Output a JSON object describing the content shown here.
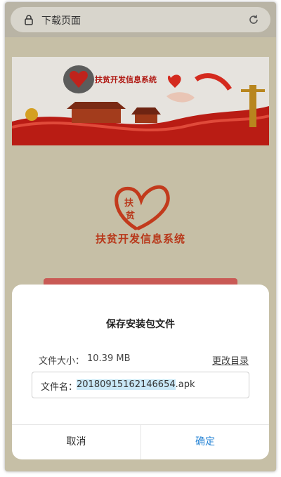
{
  "browser": {
    "page_title": "下载页面"
  },
  "page": {
    "banner_title": "扶贫开发信息系统",
    "logo_caption": "扶贫开发信息系统",
    "logo_glyph": "扶\n贫"
  },
  "dialog": {
    "title": "保存安装包文件",
    "size_label": "文件大小：",
    "size_value": "10.39 MB",
    "change_dir": "更改目录",
    "name_label": "文件名：",
    "name_selected": "20180915162146654",
    "name_ext": ".apk",
    "cancel": "取消",
    "confirm": "确定"
  },
  "colors": {
    "accent": "#2a86d6",
    "brand_red": "#b8381a",
    "selection": "#c9e8f7"
  }
}
